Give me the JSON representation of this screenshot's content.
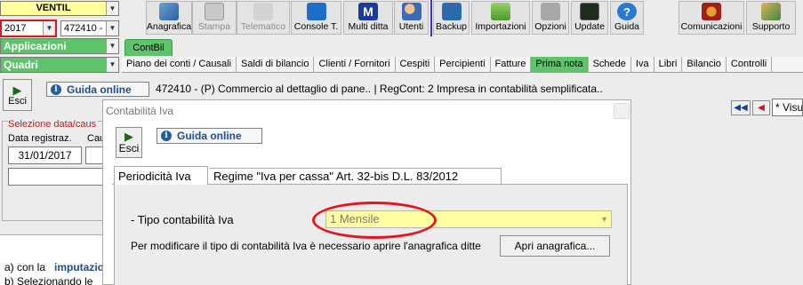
{
  "left_panel": {
    "company_code": "VENTIL",
    "year": "2017",
    "company_id": "472410 -",
    "applicazioni": "Applicazioni",
    "quadri": "Quadri"
  },
  "toolbar": [
    {
      "label": "Anagrafica",
      "icon": "book-globe-icon",
      "enabled": true
    },
    {
      "label": "Stampa",
      "icon": "printer-icon",
      "enabled": false
    },
    {
      "label": "Telematico",
      "icon": "feather-icon",
      "enabled": false
    },
    {
      "label": "Console T.",
      "icon": "console-icon",
      "enabled": true
    },
    {
      "label": "Multi ditta",
      "icon": "m-letter-icon",
      "enabled": true
    },
    {
      "label": "Utenti",
      "icon": "users-icon",
      "enabled": true
    },
    {
      "label": "Backup",
      "icon": "backup-icon",
      "enabled": true
    },
    {
      "label": "Importazioni",
      "icon": "import-icon",
      "enabled": true
    },
    {
      "label": "Opzioni",
      "icon": "wrench-icon",
      "enabled": true
    },
    {
      "label": "Update",
      "icon": "update-monitor-icon",
      "enabled": true
    },
    {
      "label": "Guida",
      "icon": "help-icon",
      "enabled": true
    },
    {
      "label": "Comunicazioni",
      "icon": "communications-icon",
      "enabled": true
    },
    {
      "label": "Supporto",
      "icon": "support-icon",
      "enabled": true
    }
  ],
  "app_tab": "ContBil",
  "menu": [
    "Piano dei conti / Causali",
    "Saldi di bilancio",
    "Clienti / Fornitori",
    "Cespiti",
    "Percipienti",
    "Fatture",
    "Prima nota",
    "Schede",
    "Iva",
    "Libri",
    "Bilancio",
    "Controlli"
  ],
  "menu_active": "Prima nota",
  "main": {
    "esci_label": "Esci",
    "guida_label": "Guida online",
    "company_line": "472410 - (P) Commercio al dettaglio di pane.. | RegCont: 2 Impresa  in contabilità semplificata..",
    "selection_label": "Selezione data/caus",
    "data_label": "Data registraz.",
    "cau_label": "Cau",
    "date_value": "31/01/2017",
    "visual_text": "* Visu",
    "notes": [
      "a) con la",
      "imputazio",
      "b) Selezionando le"
    ]
  },
  "dialog": {
    "title": "Contabilità Iva",
    "esci_label": "Esci",
    "guida_label": "Guida online",
    "tabs": [
      "Periodicità Iva",
      "Regime \"Iva per cassa\" Art. 32-bis D.L. 83/2012"
    ],
    "tipo_label": "- Tipo contabilità Iva",
    "tipo_value": "1 Mensile",
    "note": "Per modificare il tipo di contabilità Iva è necessario aprire l'anagrafica ditte",
    "apri_button": "Apri anagrafica..."
  },
  "colors": {
    "green": "#5ec46b",
    "yellow": "#ffffa0",
    "highlight_red": "#e8141c",
    "link_blue": "#1c4f8a"
  }
}
